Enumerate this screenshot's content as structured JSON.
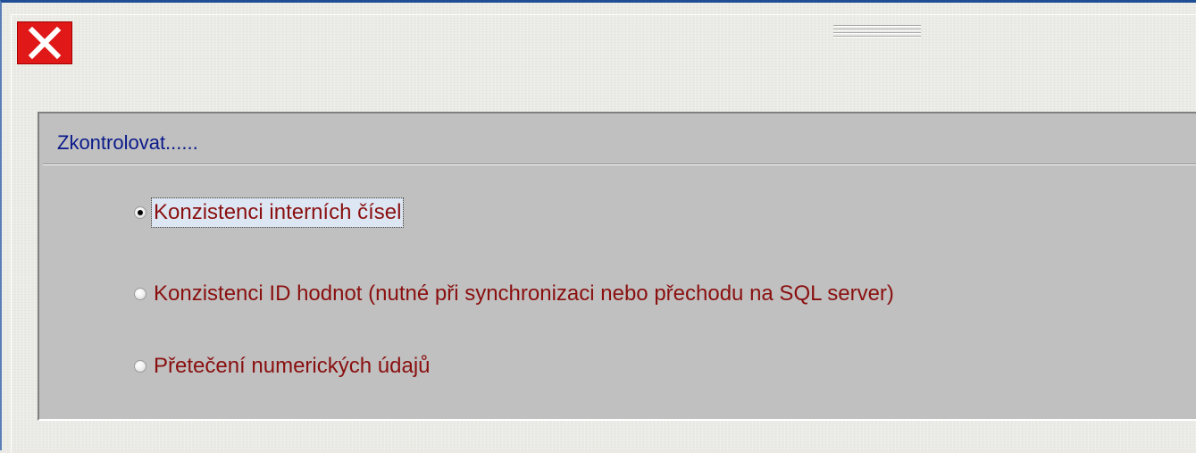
{
  "window": {
    "close_icon": "close-icon",
    "grip_icon": "drag-grip-icon"
  },
  "group": {
    "title": "Zkontrolovat......",
    "options": [
      {
        "label": "Konzistenci interních čísel",
        "selected": true
      },
      {
        "label": "Konzistenci ID hodnot (nutné při synchronizaci nebo přechodu na SQL server)",
        "selected": false
      },
      {
        "label": "Přetečení numerických údajů",
        "selected": false
      }
    ]
  },
  "colors": {
    "title_text": "#0a1a8a",
    "option_text": "#8a0f0f",
    "close_button": "#e01818",
    "group_background": "#c0c0c0",
    "window_border": "#1f4e96"
  }
}
